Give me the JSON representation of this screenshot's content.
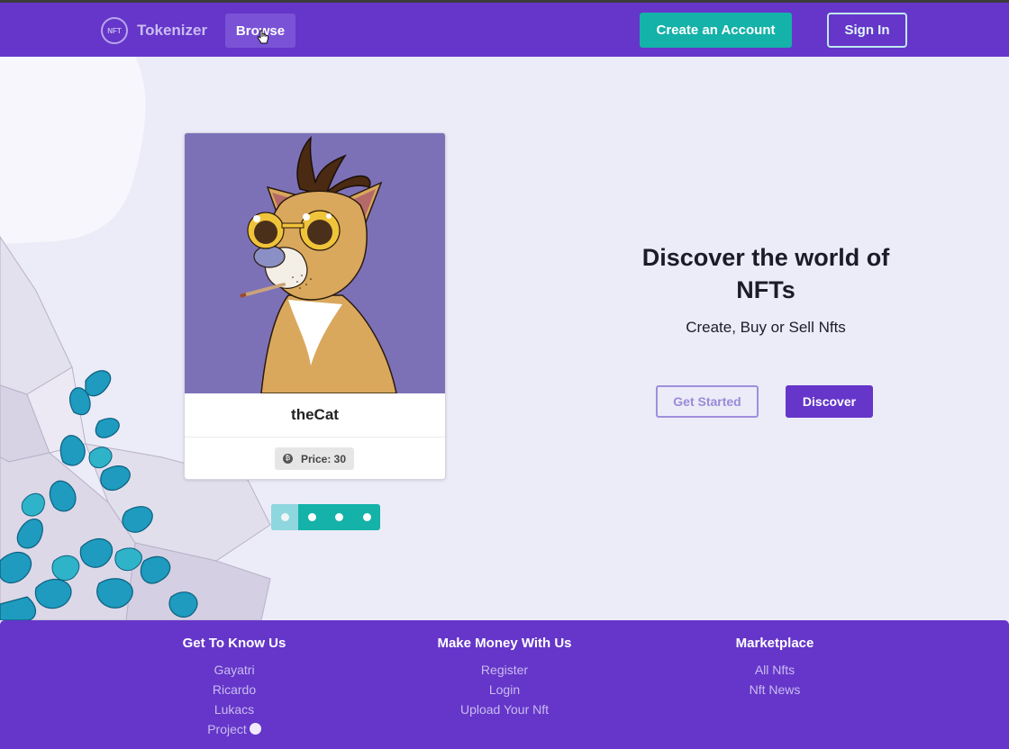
{
  "nav": {
    "brand_logo_text": "NFT",
    "brand_name": "Tokenizer",
    "browse_label": "Browse",
    "create_account_label": "Create an Account",
    "sign_in_label": "Sign In"
  },
  "hero": {
    "card": {
      "title": "theCat",
      "price_label": "Price: 30",
      "price_icon": "bitcoin-icon"
    },
    "carousel": {
      "count": 4,
      "active_index": 0
    },
    "heading": "Discover the world of NFTs",
    "subheading": "Create, Buy or Sell Nfts",
    "get_started_label": "Get Started",
    "discover_label": "Discover"
  },
  "footer": {
    "columns": [
      {
        "title": "Get To Know Us",
        "links": [
          "Gayatri",
          "Ricardo",
          "Lukacs",
          "Project"
        ]
      },
      {
        "title": "Make Money With Us",
        "links": [
          "Register",
          "Login",
          "Upload Your Nft"
        ]
      },
      {
        "title": "Marketplace",
        "links": [
          "All Nfts",
          "Nft News"
        ]
      }
    ],
    "project_icon": "github-icon"
  },
  "colors": {
    "primary": "#6536c9",
    "accent": "#14b2a8",
    "hero_bg": "#ecebf8"
  }
}
